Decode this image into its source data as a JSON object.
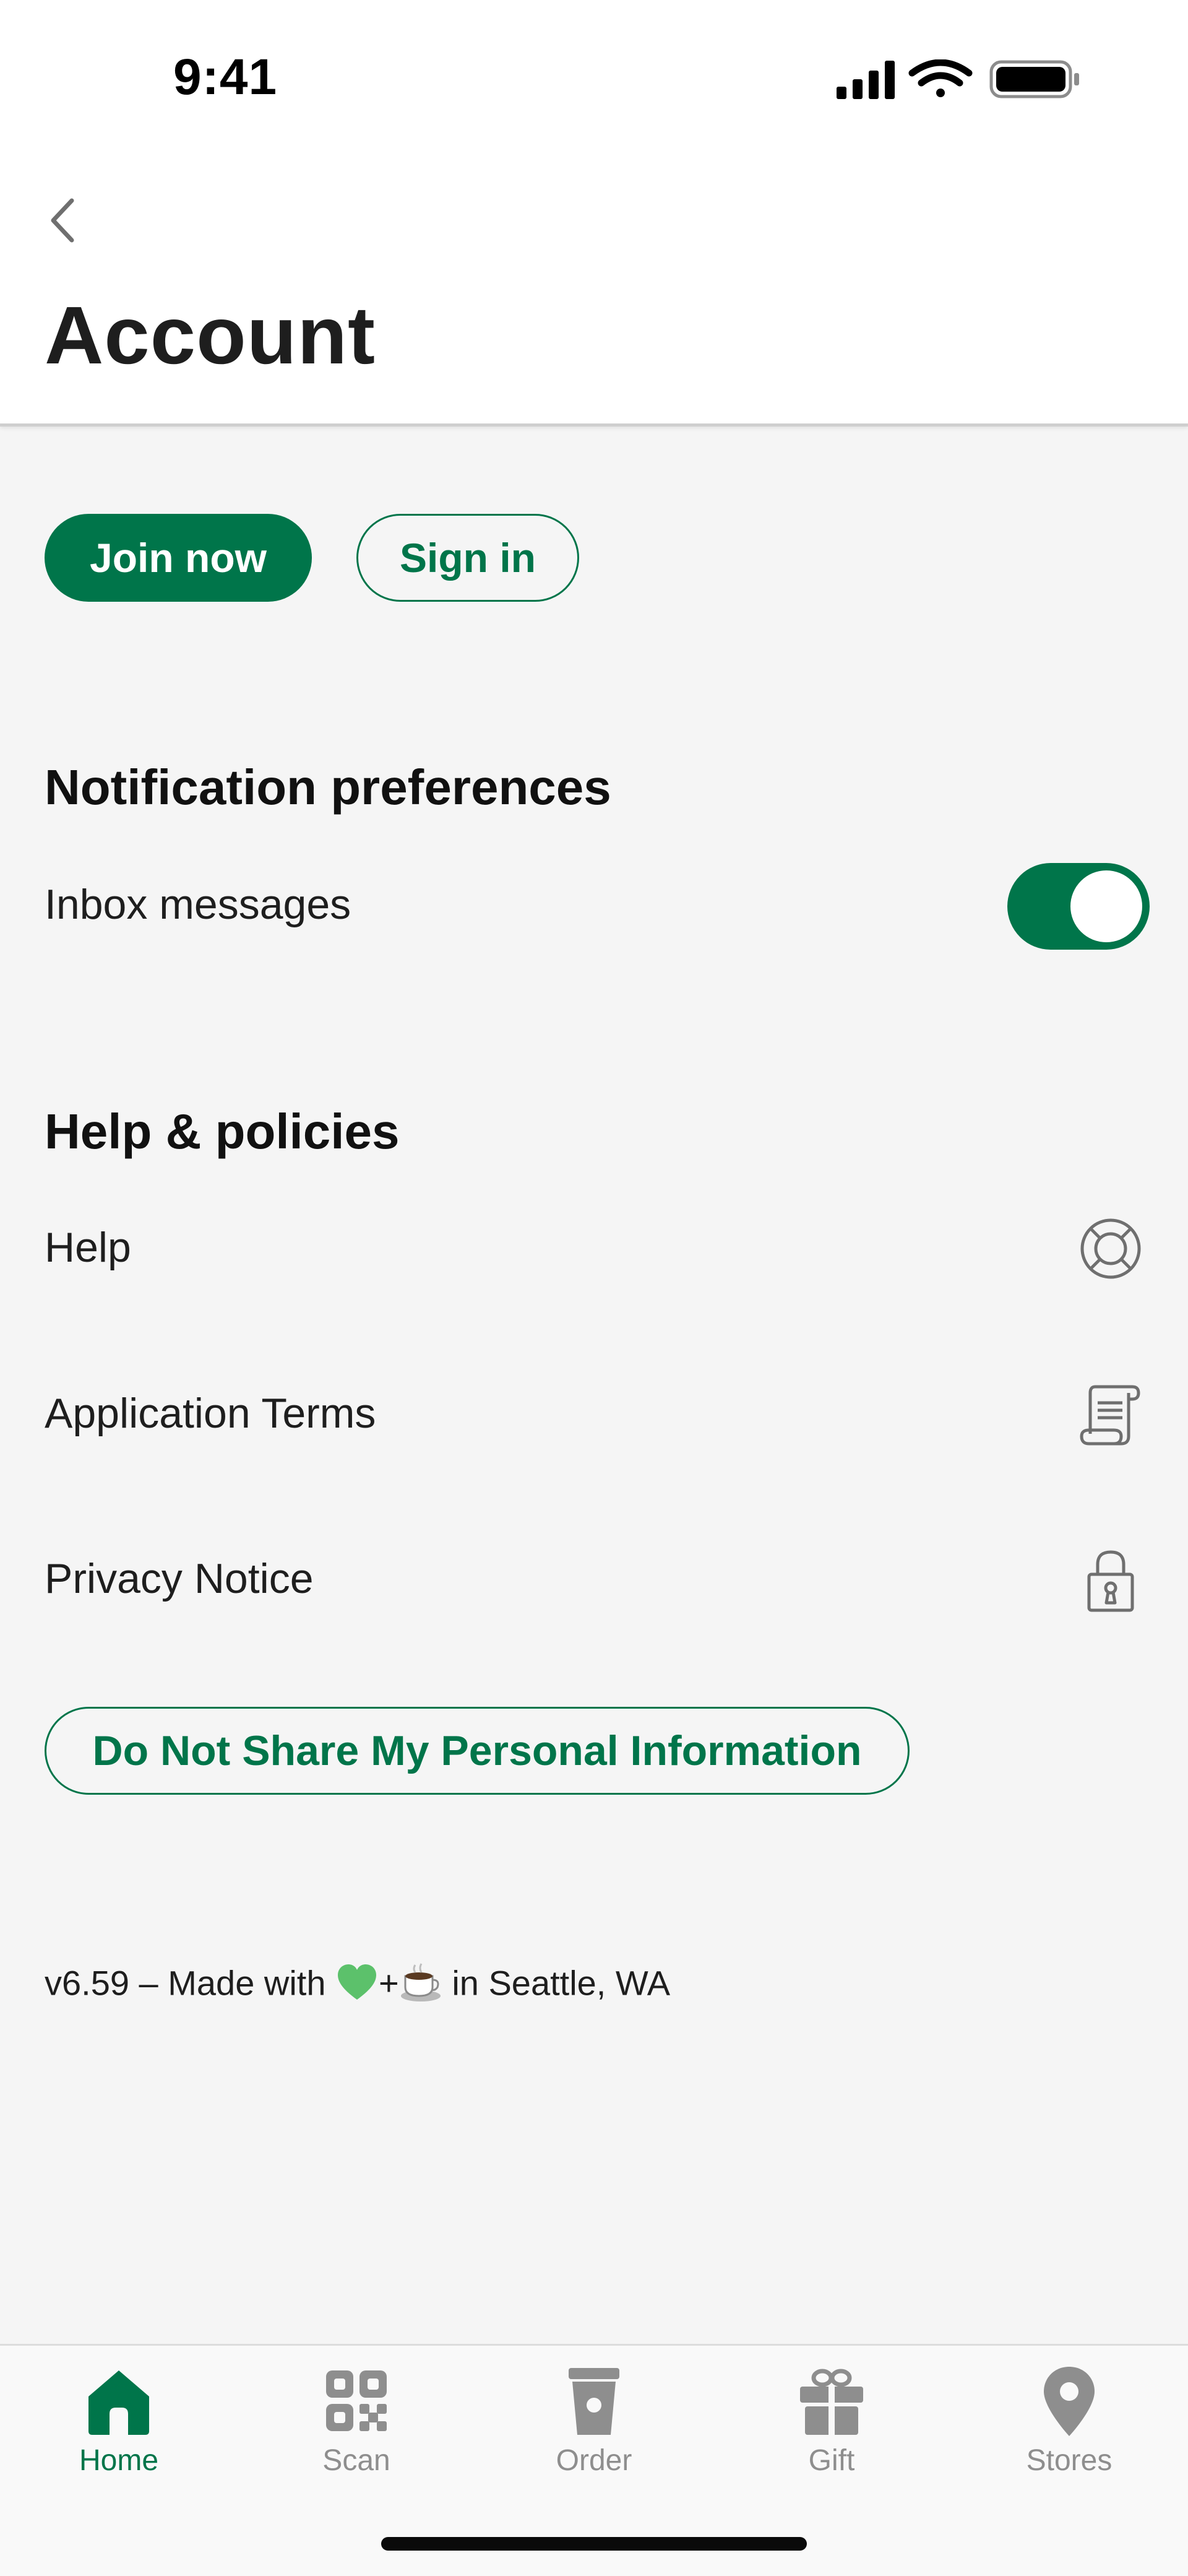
{
  "status_bar": {
    "time": "9:41"
  },
  "header": {
    "title": "Account"
  },
  "auth": {
    "join_label": "Join now",
    "sign_in_label": "Sign in"
  },
  "notifications": {
    "title": "Notification preferences",
    "inbox_label": "Inbox messages",
    "inbox_enabled": true
  },
  "help": {
    "title": "Help & policies",
    "items": [
      {
        "label": "Help",
        "icon": "lifebuoy-icon"
      },
      {
        "label": "Application Terms",
        "icon": "scroll-icon"
      },
      {
        "label": "Privacy Notice",
        "icon": "lock-icon"
      }
    ],
    "dns_label": "Do Not Share My Personal Information"
  },
  "footer": {
    "version_prefix": "v6.59 – Made with",
    "plus": "+",
    "version_suffix": "in Seattle, WA"
  },
  "tabbar": {
    "items": [
      {
        "label": "Home",
        "icon": "home-icon",
        "active": true
      },
      {
        "label": "Scan",
        "icon": "qr-icon",
        "active": false
      },
      {
        "label": "Order",
        "icon": "cup-icon",
        "active": false
      },
      {
        "label": "Gift",
        "icon": "gift-icon",
        "active": false
      },
      {
        "label": "Stores",
        "icon": "location-pin-icon",
        "active": false
      }
    ]
  },
  "colors": {
    "accent": "#00754a",
    "background": "#f5f5f5",
    "inactive": "#8e8e8e"
  }
}
